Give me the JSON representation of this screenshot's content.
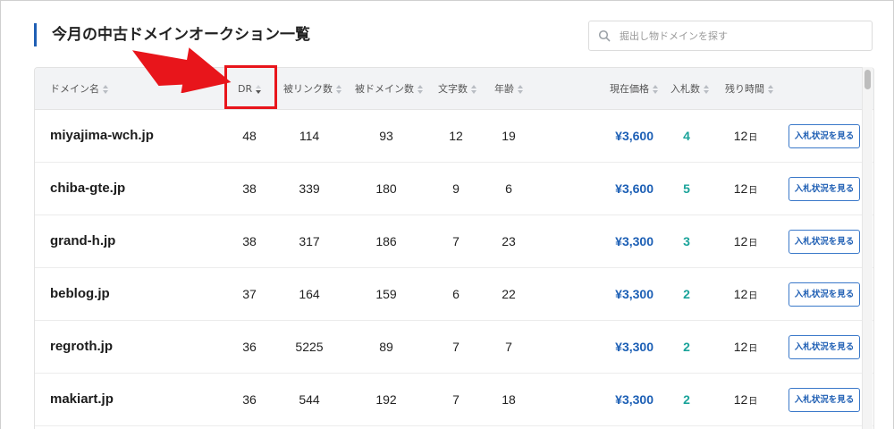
{
  "page": {
    "title": "今月の中古ドメインオークション一覧",
    "search_placeholder": "掘出し物ドメインを探す"
  },
  "columns": [
    {
      "key": "domain",
      "label": "ドメイン名"
    },
    {
      "key": "dr",
      "label": "DR",
      "sort": "desc"
    },
    {
      "key": "backlinks",
      "label": "被リンク数"
    },
    {
      "key": "ref_domains",
      "label": "被ドメイン数"
    },
    {
      "key": "chars",
      "label": "文字数"
    },
    {
      "key": "age",
      "label": "年齢"
    },
    {
      "key": "price",
      "label": "現在価格"
    },
    {
      "key": "bids",
      "label": "入札数"
    },
    {
      "key": "remaining",
      "label": "残り時間"
    }
  ],
  "rows": [
    {
      "domain": "miyajima-wch.jp",
      "dr": "48",
      "backlinks": "114",
      "ref_domains": "93",
      "chars": "12",
      "age": "19",
      "price": "¥3,600",
      "bids": "4",
      "remaining": "12",
      "unit": "日",
      "button": "入札状況を見る"
    },
    {
      "domain": "chiba-gte.jp",
      "dr": "38",
      "backlinks": "339",
      "ref_domains": "180",
      "chars": "9",
      "age": "6",
      "price": "¥3,600",
      "bids": "5",
      "remaining": "12",
      "unit": "日",
      "button": "入札状況を見る"
    },
    {
      "domain": "grand-h.jp",
      "dr": "38",
      "backlinks": "317",
      "ref_domains": "186",
      "chars": "7",
      "age": "23",
      "price": "¥3,300",
      "bids": "3",
      "remaining": "12",
      "unit": "日",
      "button": "入札状況を見る"
    },
    {
      "domain": "beblog.jp",
      "dr": "37",
      "backlinks": "164",
      "ref_domains": "159",
      "chars": "6",
      "age": "22",
      "price": "¥3,300",
      "bids": "2",
      "remaining": "12",
      "unit": "日",
      "button": "入札状況を見る"
    },
    {
      "domain": "regroth.jp",
      "dr": "36",
      "backlinks": "5225",
      "ref_domains": "89",
      "chars": "7",
      "age": "7",
      "price": "¥3,300",
      "bids": "2",
      "remaining": "12",
      "unit": "日",
      "button": "入札状況を見る"
    },
    {
      "domain": "makiart.jp",
      "dr": "36",
      "backlinks": "544",
      "ref_domains": "192",
      "chars": "7",
      "age": "18",
      "price": "¥3,300",
      "bids": "2",
      "remaining": "12",
      "unit": "日",
      "button": "入札状況を見る"
    }
  ],
  "colors": {
    "accent": "#1f5fb4",
    "price": "#1c5fb5",
    "bids": "#1aa39a",
    "annotation": "#e8151b"
  },
  "icons": {
    "search": "search-icon",
    "sort": "sort-arrows-icon",
    "annotation_arrow": "red-arrow-icon"
  }
}
